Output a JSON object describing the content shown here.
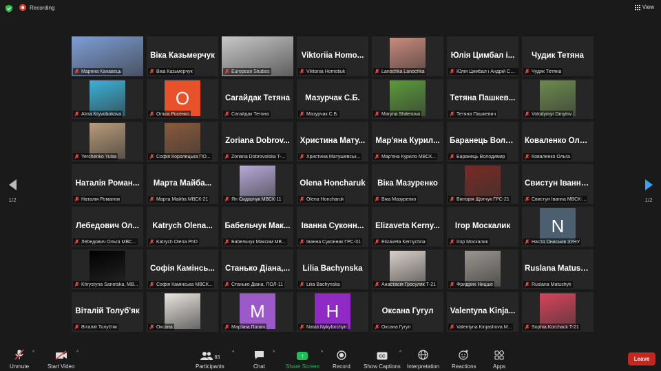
{
  "topbar": {
    "recording_label": "Recording",
    "view_label": "View"
  },
  "pagination": {
    "left": "1/2",
    "right": "1/2"
  },
  "colors": {
    "active_border": "#c9e264",
    "muted_mic": "#e04a3f",
    "leave": "#c4271f",
    "share": "#1fbd58"
  },
  "participants": [
    {
      "big": "",
      "label": "Марина Канавець",
      "kind": "photo",
      "photo_color": "#7e9ed6"
    },
    {
      "big": "Віка Казьмерчук",
      "label": "Віка Казьмерчук",
      "kind": "name"
    },
    {
      "big": "",
      "label": "European Studios",
      "kind": "video",
      "photo_color": "#c8c8c8",
      "active": true
    },
    {
      "big": "Viktoriia Homo...",
      "label": "Viktoriia Homotiuk",
      "kind": "name"
    },
    {
      "big": "",
      "label": "Lanochka Lanochka",
      "kind": "photo",
      "photo_color": "#c98a7c"
    },
    {
      "big": "Юлія Цимбал і...",
      "label": "Юлія Цимбал і Андрій Стр...",
      "kind": "name"
    },
    {
      "big": "Чудик Тетяна",
      "label": "Чудик Тетяна",
      "kind": "name"
    },
    {
      "big": "",
      "label": "Alina Kryvobokova",
      "kind": "photo",
      "photo_color": "#3ab2d8"
    },
    {
      "big": "",
      "label": "Ольга Росенко",
      "kind": "letter",
      "letter": "O",
      "letter_bg": "#e8522a"
    },
    {
      "big": "Сагайдак Тетяна",
      "label": "Сагайдак Тетяна",
      "kind": "name"
    },
    {
      "big": "Мазурчак С.Б.",
      "label": "Мазурчак С.Б.",
      "kind": "name"
    },
    {
      "big": "",
      "label": "Maryna Shilenova",
      "kind": "photo",
      "photo_color": "#5c9a3a"
    },
    {
      "big": "Тетяна Пашкев...",
      "label": "Тетяна Пашкевич",
      "kind": "name"
    },
    {
      "big": "",
      "label": "Volodymyr Dmytriv",
      "kind": "photo",
      "photo_color": "#6d8a4e"
    },
    {
      "big": "",
      "label": "Yerchenko Yuliia",
      "kind": "photo",
      "photo_color": "#b89b7a"
    },
    {
      "big": "",
      "label": "Софія Королецька ПО...",
      "kind": "photo",
      "photo_color": "#8a5a3c"
    },
    {
      "big": "Zoriana Dobrov...",
      "label": "Zoriana Dobrovolska T-...",
      "kind": "name"
    },
    {
      "big": "Христина Мату...",
      "label": "Христина Матушевськ...",
      "kind": "name"
    },
    {
      "big": "Мар'яна Курил...",
      "label": "Мар'яна Курило МВСК...",
      "kind": "name"
    },
    {
      "big": "Баранець Воло...",
      "label": "Баранець Володимир",
      "kind": "name"
    },
    {
      "big": "Коваленко Оль...",
      "label": "Коваленко Ольга",
      "kind": "name"
    },
    {
      "big": "Наталія Роман...",
      "label": "Наталія Романюк",
      "kind": "name"
    },
    {
      "big": "Марта Майба...",
      "label": "Марта Майба МВСК-21",
      "kind": "name"
    },
    {
      "big": "",
      "label": "Ян Сидорчук МВСК-11",
      "kind": "photo",
      "photo_color": "#b7a9d8"
    },
    {
      "big": "Olena Honcharuk",
      "label": "Olena Honcharuk",
      "kind": "name"
    },
    {
      "big": "Віка Мазуренко",
      "label": "Віка Мазуренко",
      "kind": "name"
    },
    {
      "big": "",
      "label": "Вікторія Щотчук ГРС-21",
      "kind": "photo",
      "photo_color": "#7a2a22"
    },
    {
      "big": "Свистун Іванна...",
      "label": "Свистун Іванна МВСК-...",
      "kind": "name"
    },
    {
      "big": "Лебедович Ол...",
      "label": "Лебедович Ольга МВС...",
      "kind": "name"
    },
    {
      "big": "Katrych Olena...",
      "label": "Katrych Olena PhD",
      "kind": "name"
    },
    {
      "big": "Бабельчук Мак...",
      "label": "Бабельчук Максим МВ...",
      "kind": "name"
    },
    {
      "big": "Іванна Суконн...",
      "label": "Іванна Суконник ГРС-31",
      "kind": "name"
    },
    {
      "big": "Elizaveta Kerny...",
      "label": "Elizaveta Kernychna",
      "kind": "name"
    },
    {
      "big": "Ігор Москалик",
      "label": "Ігор Москалик",
      "kind": "name"
    },
    {
      "big": "",
      "label": "Настя Ониськів ЗУНУ",
      "kind": "letter",
      "letter": "N",
      "letter_bg": "#4b5f70"
    },
    {
      "big": "",
      "label": "Khrystyna Sanotska, MB...",
      "kind": "photo",
      "photo_color": "#000000"
    },
    {
      "big": "Софія Камінсь...",
      "label": "Софія Камінська МВСК...",
      "kind": "name"
    },
    {
      "big": "Станько Діана,...",
      "label": "Станько Діана, ПОЛ-11",
      "kind": "name"
    },
    {
      "big": "Lilia Bachynska",
      "label": "Lilia Bachynska",
      "kind": "name"
    },
    {
      "big": "",
      "label": "Анастасія Гросуляк Т-21",
      "kind": "photo",
      "photo_color": "#d8cfc8"
    },
    {
      "big": "",
      "label": "Фридрих Ницше",
      "kind": "photo",
      "photo_color": "#9a9590"
    },
    {
      "big": "Ruslana Matush...",
      "label": "Ruslana Matushyk",
      "kind": "name"
    },
    {
      "big": "Віталій Толуб'як",
      "label": "Віталій Толуб'як",
      "kind": "name"
    },
    {
      "big": "",
      "label": "Оксана",
      "kind": "photo",
      "photo_color": "#e9e4df"
    },
    {
      "big": "",
      "label": "Мар'яна Полич",
      "kind": "letter",
      "letter": "M",
      "letter_bg": "#9b59c9"
    },
    {
      "big": "",
      "label": "Natali Nykyforchyn",
      "kind": "letter",
      "letter": "H",
      "letter_bg": "#8f2bc4"
    },
    {
      "big": "Оксана Гугул",
      "label": "Оксана Гугул",
      "kind": "name"
    },
    {
      "big": "Valentyna Kinja...",
      "label": "Valentyna Kinjashova M...",
      "kind": "name"
    },
    {
      "big": "",
      "label": "Sophia Korchack T-21",
      "kind": "photo",
      "photo_color": "#d8435a"
    }
  ],
  "toolbar": {
    "unmute": "Unmute",
    "start_video": "Start Video",
    "participants": "Participants",
    "participants_count": "83",
    "chat": "Chat",
    "share_screen": "Share Screen",
    "record": "Record",
    "show_captions": "Show Captions",
    "interpretation": "Interpretation",
    "reactions": "Reactions",
    "apps": "Apps",
    "leave": "Leave"
  }
}
